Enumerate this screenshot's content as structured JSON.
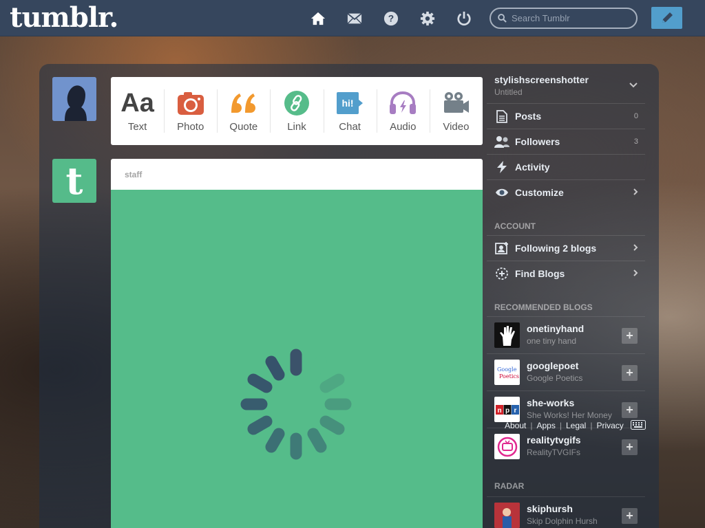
{
  "header": {
    "logo": "tumblr.",
    "search_placeholder": "Search Tumblr",
    "icons": [
      "home-icon",
      "mail-icon",
      "help-icon",
      "settings-icon",
      "power-icon"
    ],
    "compose_icon": "pencil-icon"
  },
  "post_types": [
    {
      "label": "Text",
      "icon": "Aa"
    },
    {
      "label": "Photo",
      "icon": "camera-icon"
    },
    {
      "label": "Quote",
      "icon": "quote-icon"
    },
    {
      "label": "Link",
      "icon": "link-icon"
    },
    {
      "label": "Chat",
      "icon": "hi!"
    },
    {
      "label": "Audio",
      "icon": "headphones-icon"
    },
    {
      "label": "Video",
      "icon": "video-camera-icon"
    }
  ],
  "post": {
    "author": "staff",
    "loading_icon": "spinner-icon"
  },
  "sidebar": {
    "blog_name": "stylishscreenshotter",
    "blog_title": "Untitled",
    "items": [
      {
        "label": "Posts",
        "count": "0"
      },
      {
        "label": "Followers",
        "count": "3"
      },
      {
        "label": "Activity"
      },
      {
        "label": "Customize"
      }
    ],
    "account_title": "ACCOUNT",
    "account_items": [
      {
        "label": "Following 2 blogs"
      },
      {
        "label": "Find Blogs"
      }
    ],
    "recommended_title": "RECOMMENDED BLOGS",
    "recommended": [
      {
        "name": "onetinyhand",
        "title": "one tiny hand"
      },
      {
        "name": "googlepoet",
        "title": "Google Poetics"
      },
      {
        "name": "she-works",
        "title": "She Works! Her Money"
      },
      {
        "name": "realitytvgifs",
        "title": "RealityTVGIFs"
      }
    ],
    "radar_title": "RADAR",
    "radar": [
      {
        "name": "skiphursh",
        "title": "Skip Dolphin Hursh"
      }
    ],
    "footer_links": [
      "About",
      "Apps",
      "Legal",
      "Privacy"
    ]
  },
  "colors": {
    "header_bg": "#36465d",
    "accent_blue": "#529ecc",
    "post_green": "#55bc8a",
    "photo_red": "#d95e40",
    "quote_orange": "#f2992e",
    "link_green": "#56bc8a",
    "chat_blue": "#529ecc",
    "audio_purple": "#a77dc2",
    "video_gray": "#748089"
  }
}
